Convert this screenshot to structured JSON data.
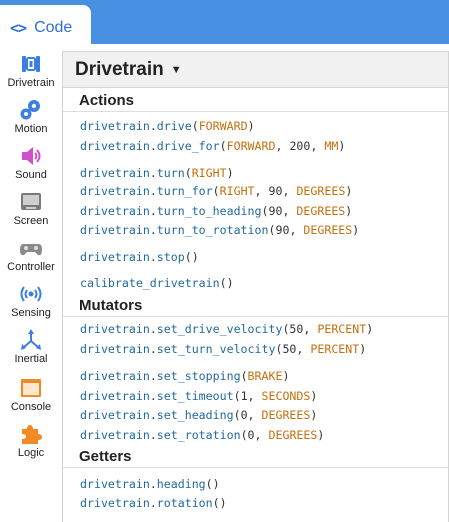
{
  "tab": {
    "label": "Code",
    "icon": "code-brackets-icon"
  },
  "categories": [
    {
      "label": "Drivetrain",
      "icon": "drivetrain-icon"
    },
    {
      "label": "Motion",
      "icon": "gears-icon"
    },
    {
      "label": "Sound",
      "icon": "speaker-icon"
    },
    {
      "label": "Screen",
      "icon": "screen-icon"
    },
    {
      "label": "Controller",
      "icon": "gamepad-icon"
    },
    {
      "label": "Sensing",
      "icon": "signal-icon"
    },
    {
      "label": "Inertial",
      "icon": "inertial-icon"
    },
    {
      "label": "Console",
      "icon": "console-icon"
    },
    {
      "label": "Logic",
      "icon": "puzzle-icon"
    }
  ],
  "panel": {
    "title": "Drivetrain",
    "sections": [
      {
        "heading": "Actions"
      },
      {
        "heading": "Mutators"
      },
      {
        "heading": "Getters"
      }
    ]
  },
  "code_lines": [
    {
      "obj": "drivetrain",
      "fn": "drive",
      "args": [
        [
          "k",
          "FORWARD"
        ]
      ]
    },
    {
      "obj": "drivetrain",
      "fn": "drive_for",
      "args": [
        [
          "k",
          "FORWARD"
        ],
        [
          "n",
          "200"
        ],
        [
          "k",
          "MM"
        ]
      ]
    },
    {
      "obj": "drivetrain",
      "fn": "turn",
      "args": [
        [
          "k",
          "RIGHT"
        ]
      ]
    },
    {
      "obj": "drivetrain",
      "fn": "turn_for",
      "args": [
        [
          "k",
          "RIGHT"
        ],
        [
          "n",
          "90"
        ],
        [
          "k",
          "DEGREES"
        ]
      ]
    },
    {
      "obj": "drivetrain",
      "fn": "turn_to_heading",
      "args": [
        [
          "n",
          "90"
        ],
        [
          "k",
          "DEGREES"
        ]
      ]
    },
    {
      "obj": "drivetrain",
      "fn": "turn_to_rotation",
      "args": [
        [
          "n",
          "90"
        ],
        [
          "k",
          "DEGREES"
        ]
      ]
    },
    {
      "obj": "drivetrain",
      "fn": "stop",
      "args": []
    },
    {
      "obj": "",
      "fn": "calibrate_drivetrain",
      "args": []
    },
    {
      "obj": "drivetrain",
      "fn": "set_drive_velocity",
      "args": [
        [
          "n",
          "50"
        ],
        [
          "k",
          "PERCENT"
        ]
      ]
    },
    {
      "obj": "drivetrain",
      "fn": "set_turn_velocity",
      "args": [
        [
          "n",
          "50"
        ],
        [
          "k",
          "PERCENT"
        ]
      ]
    },
    {
      "obj": "drivetrain",
      "fn": "set_stopping",
      "args": [
        [
          "k",
          "BRAKE"
        ]
      ]
    },
    {
      "obj": "drivetrain",
      "fn": "set_timeout",
      "args": [
        [
          "n",
          "1"
        ],
        [
          "k",
          "SECONDS"
        ]
      ]
    },
    {
      "obj": "drivetrain",
      "fn": "set_heading",
      "args": [
        [
          "n",
          "0"
        ],
        [
          "k",
          "DEGREES"
        ]
      ]
    },
    {
      "obj": "drivetrain",
      "fn": "set_rotation",
      "args": [
        [
          "n",
          "0"
        ],
        [
          "k",
          "DEGREES"
        ]
      ]
    },
    {
      "obj": "drivetrain",
      "fn": "heading",
      "args": []
    },
    {
      "obj": "drivetrain",
      "fn": "rotation",
      "args": []
    }
  ],
  "colors": {
    "top_bar": "#4a90e2",
    "accent": "#2f6fd0",
    "code_object": "#206a9e",
    "code_constant": "#c4700e",
    "category_blue": "#3b7fe0",
    "category_pink": "#d14fc8",
    "category_orange": "#f08a24"
  }
}
